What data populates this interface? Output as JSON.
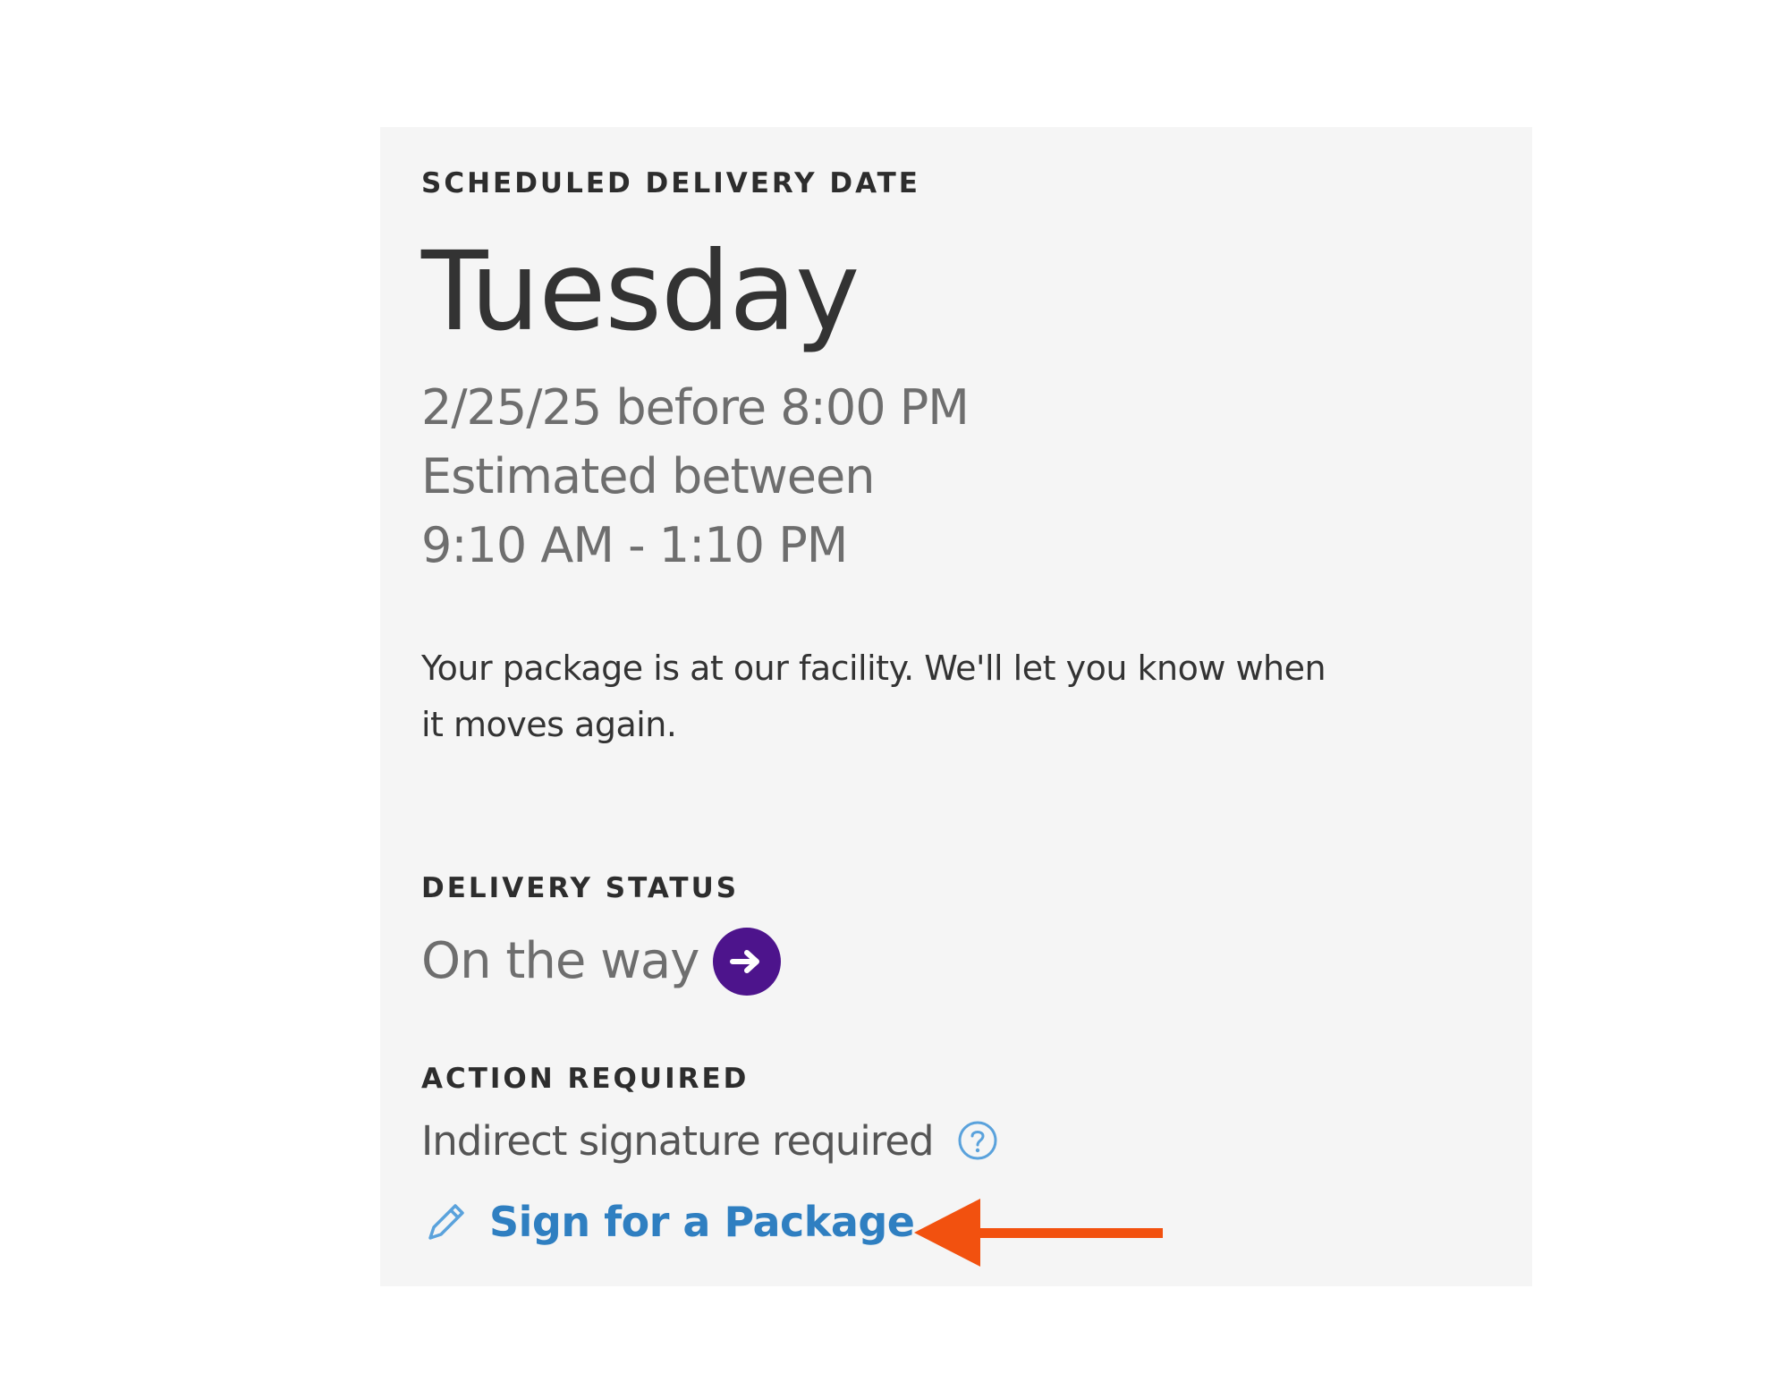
{
  "scheduled": {
    "label": "SCHEDULED DELIVERY DATE",
    "day": "Tuesday",
    "date_line": "2/25/25 before 8:00 PM",
    "estimate_line1": "Estimated between",
    "estimate_line2": "9:10 AM - 1:10 PM",
    "message": "Your package is at our facility. We'll let you know when it moves again."
  },
  "delivery_status": {
    "label": "DELIVERY STATUS",
    "value": "On the way",
    "icon": "arrow-right-circle-icon"
  },
  "action": {
    "label": "ACTION REQUIRED",
    "signature_text": "Indirect signature required",
    "help_icon": "question-circle-icon",
    "sign_link": "Sign for a Package",
    "sign_icon": "pencil-icon"
  },
  "colors": {
    "card_background": "#f5f5f5",
    "status_icon": "#4d148c",
    "link": "#2f7fc1",
    "callout_arrow": "#f2510f"
  }
}
